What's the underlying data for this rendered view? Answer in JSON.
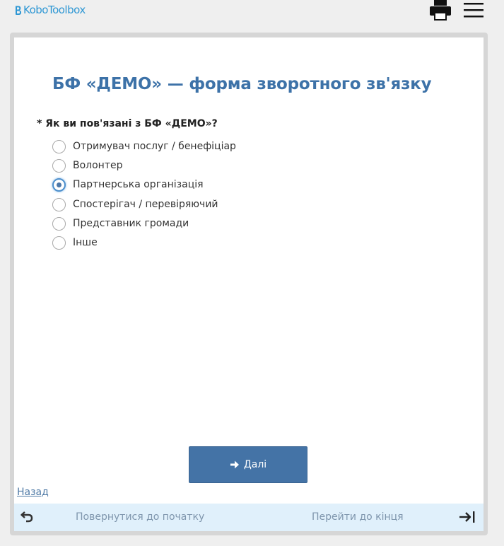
{
  "header": {
    "logo_text_kobo": "Kobo",
    "logo_text_toolbox": "Toolbox",
    "print_icon": "printer-icon",
    "menu_icon": "hamburger-menu-icon"
  },
  "form": {
    "title": "БФ «ДЕМО» — форма зворотного зв'язку",
    "question": {
      "label": "* Як ви пов'язані з БФ «ДЕМО»?",
      "options": [
        {
          "label": "Отримувач послуг / бенефіціар",
          "selected": false
        },
        {
          "label": "Волонтер",
          "selected": false
        },
        {
          "label": "Партнерська організація",
          "selected": true
        },
        {
          "label": "Спостерігач / перевіряючий",
          "selected": false
        },
        {
          "label": "Представник громади",
          "selected": false
        },
        {
          "label": "Інше",
          "selected": false
        }
      ]
    },
    "next_label": "Далі",
    "back_label": "Назад"
  },
  "footer": {
    "return_label": "Повернутися до початку",
    "goto_end_label": "Перейти до кінця"
  },
  "colors": {
    "title": "#3d72a8",
    "button": "#4473a6",
    "footer_bg": "#e0f0fb",
    "logo": "#2e97d4"
  }
}
